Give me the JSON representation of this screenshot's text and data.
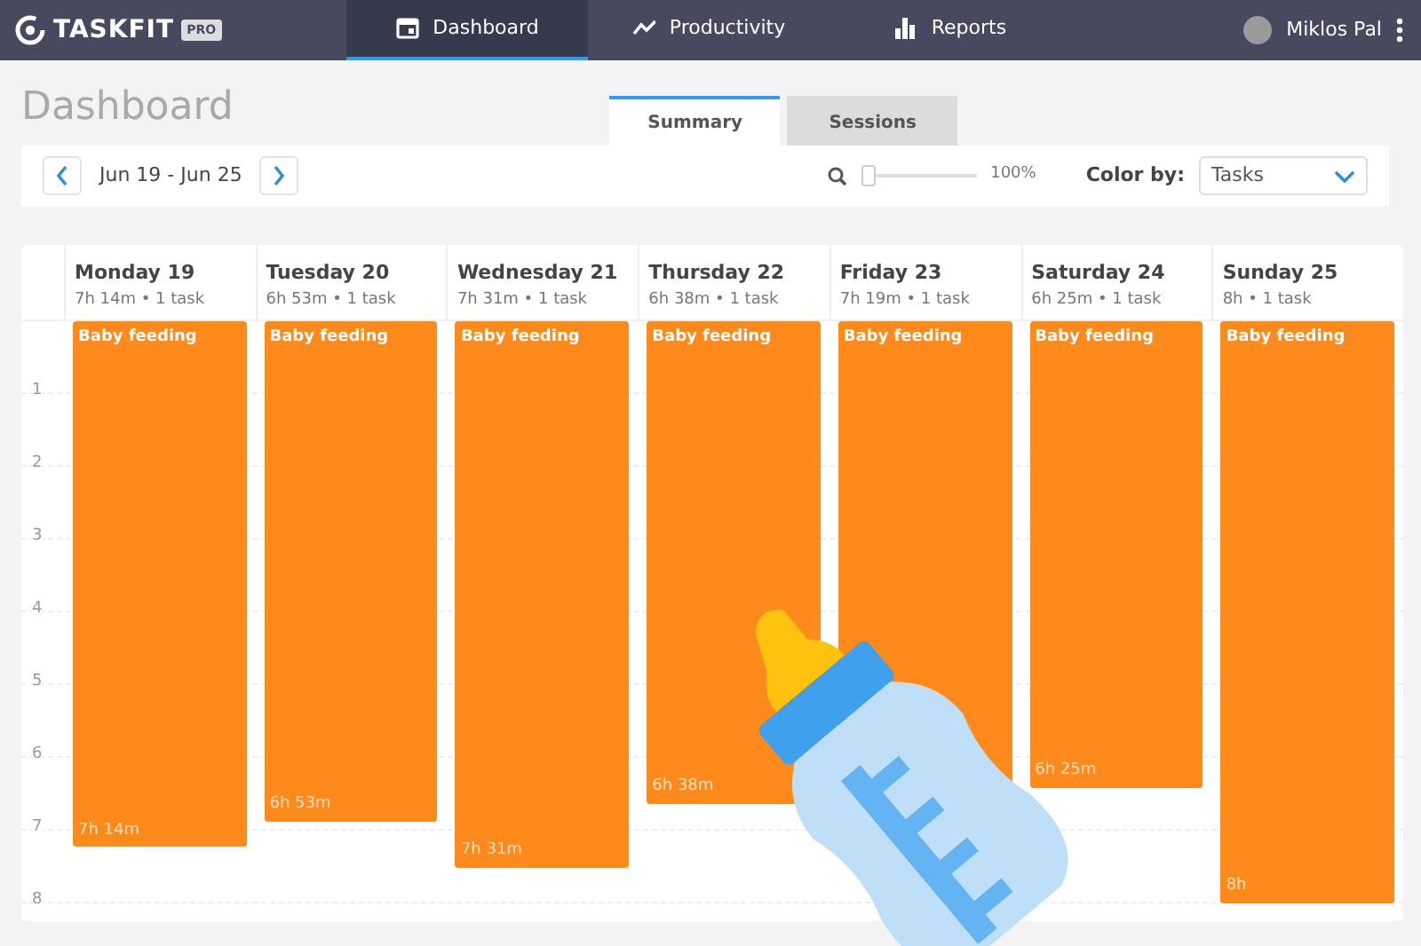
{
  "navbar": {
    "brand": "TASKFIT",
    "brand_badge": "PRO",
    "items": [
      {
        "label": "Dashboard",
        "selected": true
      },
      {
        "label": "Productivity",
        "selected": false
      },
      {
        "label": "Reports",
        "selected": false
      }
    ],
    "user": {
      "name": "Miklos Pal"
    }
  },
  "page_title": "Dashboard",
  "view_tabs": [
    {
      "label": "Summary",
      "selected": true
    },
    {
      "label": "Sessions",
      "selected": false
    }
  ],
  "toolbar": {
    "date_range": "Jun 19 - Jun 25",
    "zoom": {
      "level": 0,
      "reading": "100%"
    },
    "color_by": {
      "label": "Color by:",
      "value": "Tasks"
    }
  },
  "calendar": {
    "hour_labels": [
      "1",
      "2",
      "3",
      "4",
      "5",
      "6",
      "7",
      "8"
    ],
    "days": [
      {
        "name": "Monday 19",
        "summary": "7h 14m • 1 task",
        "events": [
          {
            "title": "Baby feeding",
            "duration": "7h 14m",
            "level": 0.877
          }
        ]
      },
      {
        "name": "Tuesday 20",
        "summary": "6h 53m • 1 task",
        "events": [
          {
            "title": "Baby feeding",
            "duration": "6h 53m",
            "level": 0.834
          }
        ]
      },
      {
        "name": "Wednesday 21",
        "summary": "7h 31m • 1 task",
        "events": [
          {
            "title": "Baby feeding",
            "duration": "7h 31m",
            "level": 0.911
          }
        ]
      },
      {
        "name": "Thursday 22",
        "summary": "6h 38m • 1 task",
        "events": [
          {
            "title": "Baby feeding",
            "duration": "6h 38m",
            "level": 0.804
          }
        ]
      },
      {
        "name": "Friday 23",
        "summary": "7h 19m • 1 task",
        "events": [
          {
            "title": "Baby feeding",
            "level": 0.887
          }
        ]
      },
      {
        "name": "Saturday 24",
        "summary": "6h 25m • 1 task",
        "events": [
          {
            "title": "Baby feeding",
            "duration": "6h 25m",
            "level": 0.778
          }
        ]
      },
      {
        "name": "Sunday 25",
        "summary": "8h • 1 task",
        "events": [
          {
            "title": "Baby feeding",
            "duration": "8h",
            "level": 0.97
          }
        ]
      }
    ]
  }
}
